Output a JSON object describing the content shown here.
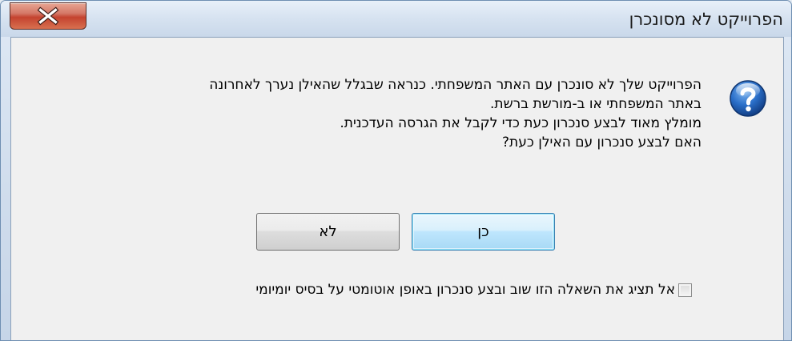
{
  "window": {
    "title": "הפרוייקט לא מסונכרן"
  },
  "icons": {
    "close": "close-icon",
    "question": "question-icon"
  },
  "message": {
    "lines": [
      "הפרוייקט שלך לא סונכרן עם האתר המשפחתי. כנראה שבגלל שהאילן נערך לאחרונה",
      "באתר המשפחתי או ב-מורשת ברשת.",
      "מומלץ מאוד לבצע סנכרון כעת כדי לקבל את הגרסה העדכנית.",
      "האם לבצע סנכרון עם האילן כעת?"
    ]
  },
  "buttons": {
    "yes_label": "כן",
    "no_label": "לא"
  },
  "checkbox": {
    "label": "אל תציג את השאלה הזו שוב ובצע סנכרון באופן אוטומטי על בסיס יומיומי",
    "checked": false
  },
  "colors": {
    "close_red": "#c4432f",
    "question_blue": "#1d5fb8",
    "default_button_border": "#3c7fb1"
  }
}
